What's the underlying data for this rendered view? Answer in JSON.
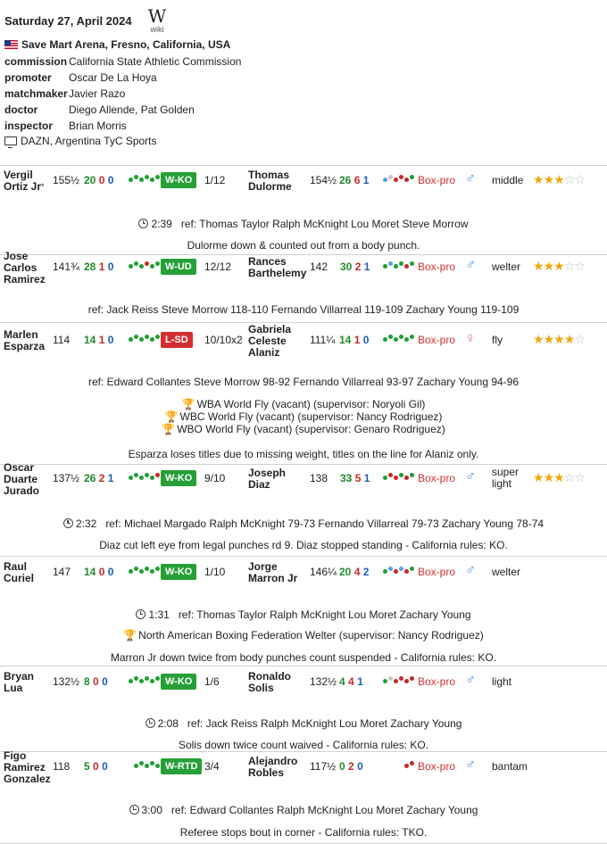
{
  "header": {
    "date": "Saturday 27, April 2024",
    "wiki_symbol": "W",
    "wiki_label": "wiki",
    "venue": "Save Mart Arena, Fresno, California, USA",
    "flag_icon": "us-flag-icon",
    "rows": [
      {
        "key": "commission",
        "value": "California State Athletic Commission"
      },
      {
        "key": "promoter",
        "value": "Oscar De La Hoya"
      },
      {
        "key": "matchmaker",
        "value": "Javier Razo"
      },
      {
        "key": "doctor",
        "value": "Diego Allende, Pat Golden"
      },
      {
        "key": "inspector",
        "value": "Brian Morris"
      }
    ],
    "tv": "DAZN, Argentina TyC Sports"
  },
  "tag_label": "Box-pro",
  "bouts": [
    {
      "f1_name": [
        "Vergil",
        "Ortiz Jr"
      ],
      "f1_mark": "*",
      "f1_weight": "155½",
      "f1_rec": [
        "20",
        "0",
        "0"
      ],
      "f1_form": [
        "w",
        "w",
        "w",
        "w",
        "w",
        "w"
      ],
      "result": "W-KO",
      "rounds": "1/12",
      "f2_name": [
        "Thomas",
        "Dulorme"
      ],
      "f2_weight": "154½",
      "f2_rec": [
        "26",
        "6",
        "1"
      ],
      "f2_form": [
        "d",
        "n",
        "l",
        "l",
        "l",
        "w"
      ],
      "sex": "male",
      "division": [
        "middle"
      ],
      "stars": 3,
      "time": "2:39",
      "officials": "ref: Thomas Taylor   Ralph McKnight   Lou Moret   Steve Morrow",
      "titles": [],
      "note": "Dulorme down & counted out from a body punch."
    },
    {
      "f1_name": [
        "Jose",
        "Carlos",
        "Ramirez"
      ],
      "f1_mark": "",
      "f1_weight": "141¾",
      "f1_rec": [
        "28",
        "1",
        "0"
      ],
      "f1_form": [
        "w",
        "w",
        "w",
        "l",
        "w",
        "w"
      ],
      "result": "W-UD",
      "rounds": "12/12",
      "f2_name": [
        "Rances",
        "Barthelemy"
      ],
      "f2_weight": "142",
      "f2_rec": [
        "30",
        "2",
        "1"
      ],
      "f2_form": [
        "w",
        "d",
        "w",
        "w",
        "l",
        "w"
      ],
      "sex": "male",
      "division": [
        "welter"
      ],
      "stars": 3,
      "time": "",
      "officials": "ref: Jack Reiss   Steve Morrow 118-110   Fernando Villarreal 119-109   Zachary Young 119-109",
      "titles": [],
      "note": ""
    },
    {
      "f1_name": [
        "Marlen",
        "Esparza"
      ],
      "f1_mark": "",
      "f1_weight": "114",
      "f1_rec": [
        "14",
        "1",
        "0"
      ],
      "f1_form": [
        "w",
        "w",
        "w",
        "w",
        "w",
        "w"
      ],
      "result": "L-SD",
      "rounds": "10/10x2",
      "f2_name": [
        "Gabriela",
        "Celeste",
        "Alaniz"
      ],
      "f2_weight": "111¼",
      "f2_rec": [
        "14",
        "1",
        "0"
      ],
      "f2_form": [
        "w",
        "w",
        "w",
        "w",
        "w",
        "w"
      ],
      "sex": "female",
      "division": [
        "fly"
      ],
      "stars": 4,
      "time": "",
      "officials": "ref: Edward Collantes   Steve Morrow 98-92   Fernando Villarreal 93-97   Zachary Young 94-96",
      "titles": [
        "WBA World Fly (vacant) (supervisor: Noryoli Gil)",
        "WBC World Fly (vacant) (supervisor: Nancy Rodriguez)",
        "WBO World Fly (vacant) (supervisor: Genaro Rodriguez)"
      ],
      "note": "Esparza loses titles due to missing weight, titles on the line for Alaniz only."
    },
    {
      "f1_name": [
        "Oscar",
        "Duarte",
        "Jurado"
      ],
      "f1_mark": "",
      "f1_weight": "137½",
      "f1_rec": [
        "26",
        "2",
        "1"
      ],
      "f1_form": [
        "w",
        "w",
        "w",
        "w",
        "w",
        "l"
      ],
      "result": "W-KO",
      "rounds": "9/10",
      "f2_name": [
        "Joseph",
        "Diaz"
      ],
      "f2_weight": "138",
      "f2_rec": [
        "33",
        "5",
        "1"
      ],
      "f2_form": [
        "w",
        "l",
        "l",
        "w",
        "l",
        "w"
      ],
      "sex": "male",
      "division": [
        "super",
        "light"
      ],
      "stars": 3,
      "time": "2:32",
      "officials": "ref: Michael Margado   Ralph McKnight 79-73   Fernando Villarreal 79-73   Zachary Young 78-74",
      "titles": [],
      "note": "Diaz cut left eye from legal punches rd 9. Diaz stopped standing - California rules: KO."
    },
    {
      "f1_name": [
        "Raul",
        "Curiel"
      ],
      "f1_mark": "",
      "f1_weight": "147",
      "f1_rec": [
        "14",
        "0",
        "0"
      ],
      "f1_form": [
        "w",
        "w",
        "w",
        "w",
        "w",
        "w"
      ],
      "result": "W-KO",
      "rounds": "1/10",
      "f2_name": [
        "Jorge",
        "Marron Jr"
      ],
      "f2_weight": "146¼",
      "f2_rec": [
        "20",
        "4",
        "2"
      ],
      "f2_form": [
        "w",
        "d",
        "l",
        "d",
        "l",
        "w"
      ],
      "sex": "male",
      "division": [
        "welter"
      ],
      "stars": 0,
      "time": "1:31",
      "officials": "ref: Thomas Taylor   Ralph McKnight   Lou Moret   Zachary Young",
      "titles": [
        "North American Boxing Federation Welter (supervisor: Nancy Rodriguez)"
      ],
      "note": "Marron Jr down twice from body punches count suspended - California rules: KO."
    },
    {
      "f1_name": [
        "Bryan",
        "Lua"
      ],
      "f1_mark": "",
      "f1_weight": "132½",
      "f1_rec": [
        "8",
        "0",
        "0"
      ],
      "f1_form": [
        "w",
        "w",
        "w",
        "w",
        "w",
        "w"
      ],
      "result": "W-KO",
      "rounds": "1/6",
      "f2_name": [
        "Ronaldo",
        "Solis"
      ],
      "f2_weight": "132½",
      "f2_rec": [
        "4",
        "4",
        "1"
      ],
      "f2_form": [
        "w",
        "n",
        "l",
        "l",
        "l",
        "l"
      ],
      "sex": "male",
      "division": [
        "light"
      ],
      "stars": 0,
      "time": "2:08",
      "officials": "ref: Jack Reiss   Ralph McKnight   Lou Moret   Zachary Young",
      "titles": [],
      "note": "Solis down twice count waived - California rules: KO."
    },
    {
      "f1_name": [
        "Figo",
        "Ramirez",
        "Gonzalez"
      ],
      "f1_mark": "",
      "f1_weight": "118",
      "f1_rec": [
        "5",
        "0",
        "0"
      ],
      "f1_form": [
        "w",
        "w",
        "w",
        "w",
        "w"
      ],
      "result": "W-RTD",
      "rounds": "3/4",
      "f2_name": [
        "Alejandro",
        "Robles"
      ],
      "f2_weight": "117½",
      "f2_rec": [
        "0",
        "2",
        "0"
      ],
      "f2_form": [
        "l",
        "l"
      ],
      "sex": "male",
      "division": [
        "bantam"
      ],
      "stars": 0,
      "time": "3:00",
      "officials": "ref: Edward Collantes   Ralph McKnight   Lou Moret   Zachary Young",
      "titles": [],
      "note": "Referee stops bout in corner - California rules: TKO."
    }
  ]
}
